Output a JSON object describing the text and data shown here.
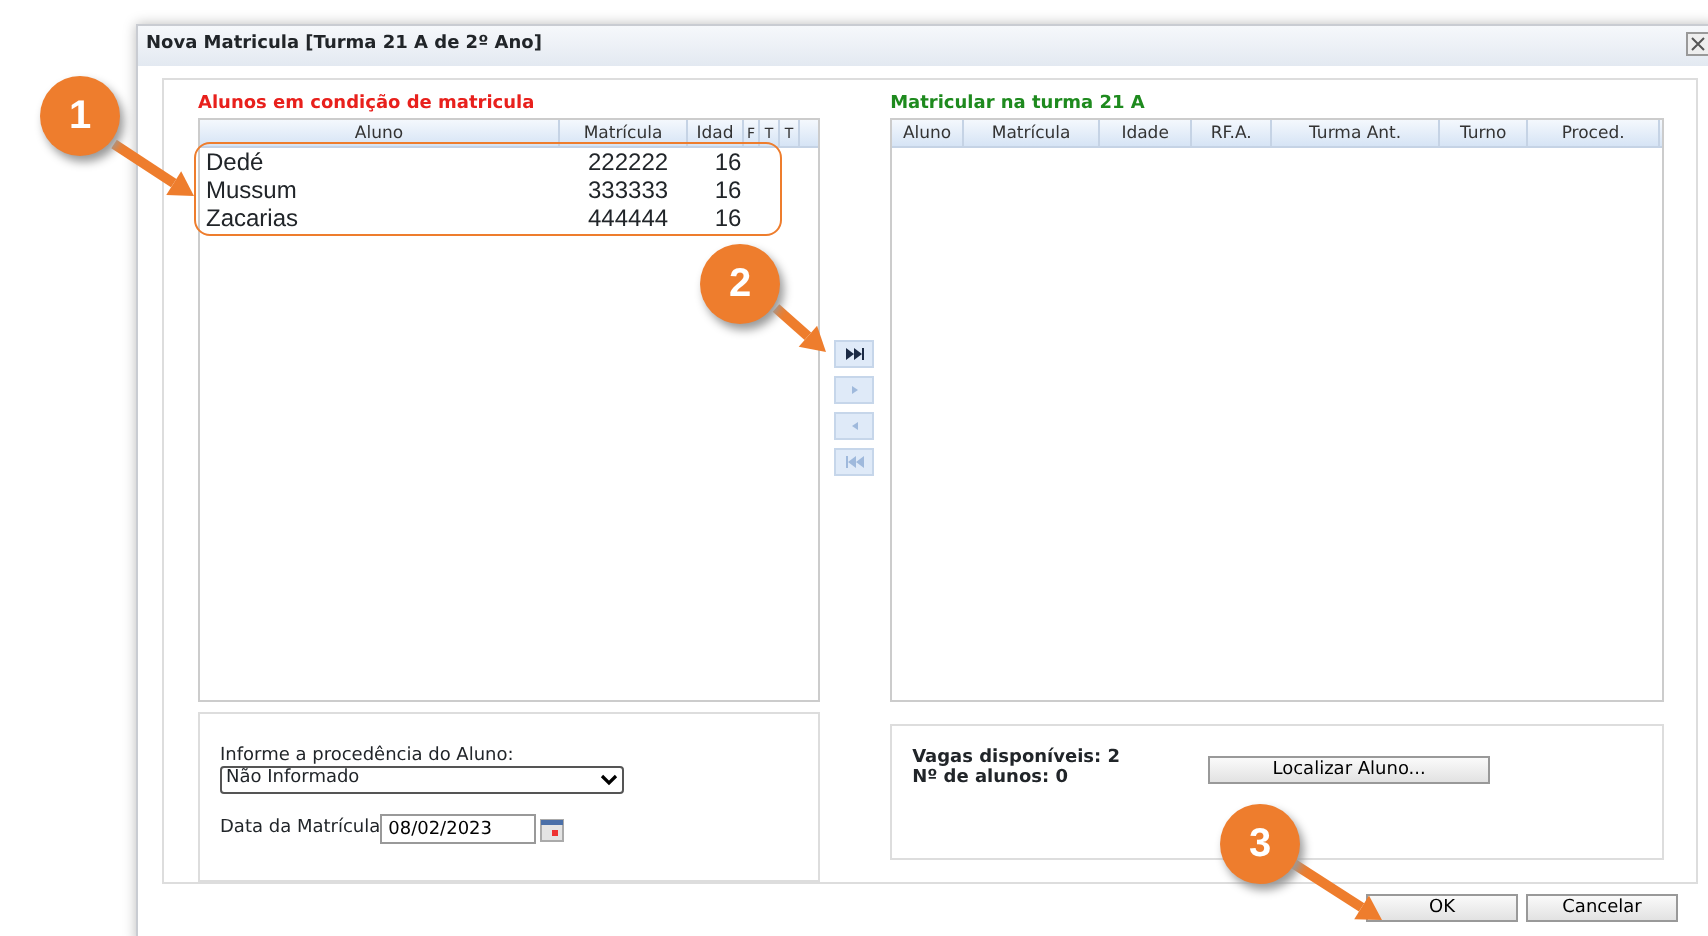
{
  "dialog": {
    "title": "Nova Matricula [Turma 21 A de 2º Ano]"
  },
  "available": {
    "heading": "Alunos em condição de matricula",
    "columns": [
      "Aluno",
      "Matrícula",
      "Idad",
      "F",
      "T",
      "T"
    ],
    "rows": [
      [
        "Dedé",
        "222222",
        "16"
      ],
      [
        "Mussum",
        "333333",
        "16"
      ],
      [
        "Zacarias",
        "444444",
        "16"
      ]
    ]
  },
  "move_buttons": [
    {
      "kind": "all-right",
      "disabled": false
    },
    {
      "kind": "right",
      "disabled": true
    },
    {
      "kind": "left",
      "disabled": true
    },
    {
      "kind": "all-left",
      "disabled": true
    }
  ],
  "enrolled": {
    "heading": "Matricular na turma 21 A",
    "columns": [
      "Aluno",
      "Matrícula",
      "Idade",
      "RF.A.",
      "Turma Ant.",
      "Turno",
      "Proced."
    ]
  },
  "origin": {
    "label": "Informe a procedência do Aluno:",
    "value": "Não Informado"
  },
  "date": {
    "label": "Data da Matrícula",
    "value": "08/02/2023"
  },
  "summary": [
    "Vagas disponíveis: 2",
    "Nº de alunos: 0"
  ],
  "locate_button": "Localizar Aluno...",
  "buttons": [
    "OK",
    "Cancelar"
  ],
  "callouts": [
    {
      "number": "1"
    },
    {
      "number": "2"
    },
    {
      "number": "3"
    }
  ]
}
